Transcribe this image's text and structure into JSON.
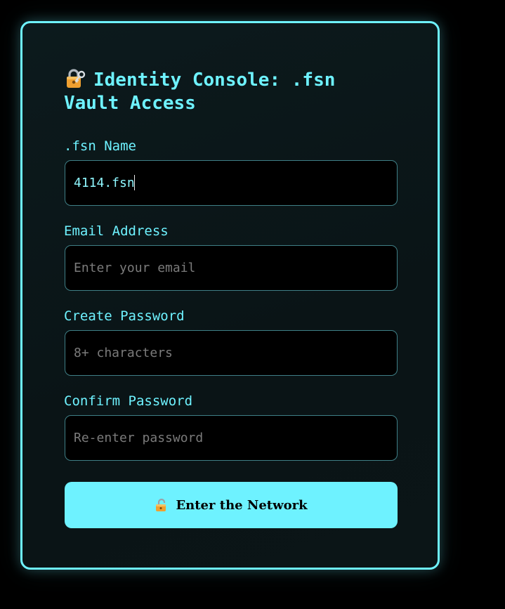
{
  "form": {
    "title_line1": "Identity Console: .fsn",
    "title_line2": "Vault Access",
    "title_icon": "lock-with-key-icon",
    "name": {
      "label": ".fsn Name",
      "value": "4114.fsn"
    },
    "email": {
      "label": "Email Address",
      "placeholder": "Enter your email"
    },
    "password": {
      "label": "Create Password",
      "placeholder": "8+ characters"
    },
    "confirm": {
      "label": "Confirm Password",
      "placeholder": "Re-enter password"
    },
    "submit": {
      "label": "Enter the Network",
      "icon": "unlocked-padlock-icon"
    }
  },
  "colors": {
    "accent": "#6ef2ff",
    "background": "#000000",
    "card": "#0c1a1d",
    "input_border": "#3f7f86",
    "placeholder": "#7b7b7b"
  }
}
